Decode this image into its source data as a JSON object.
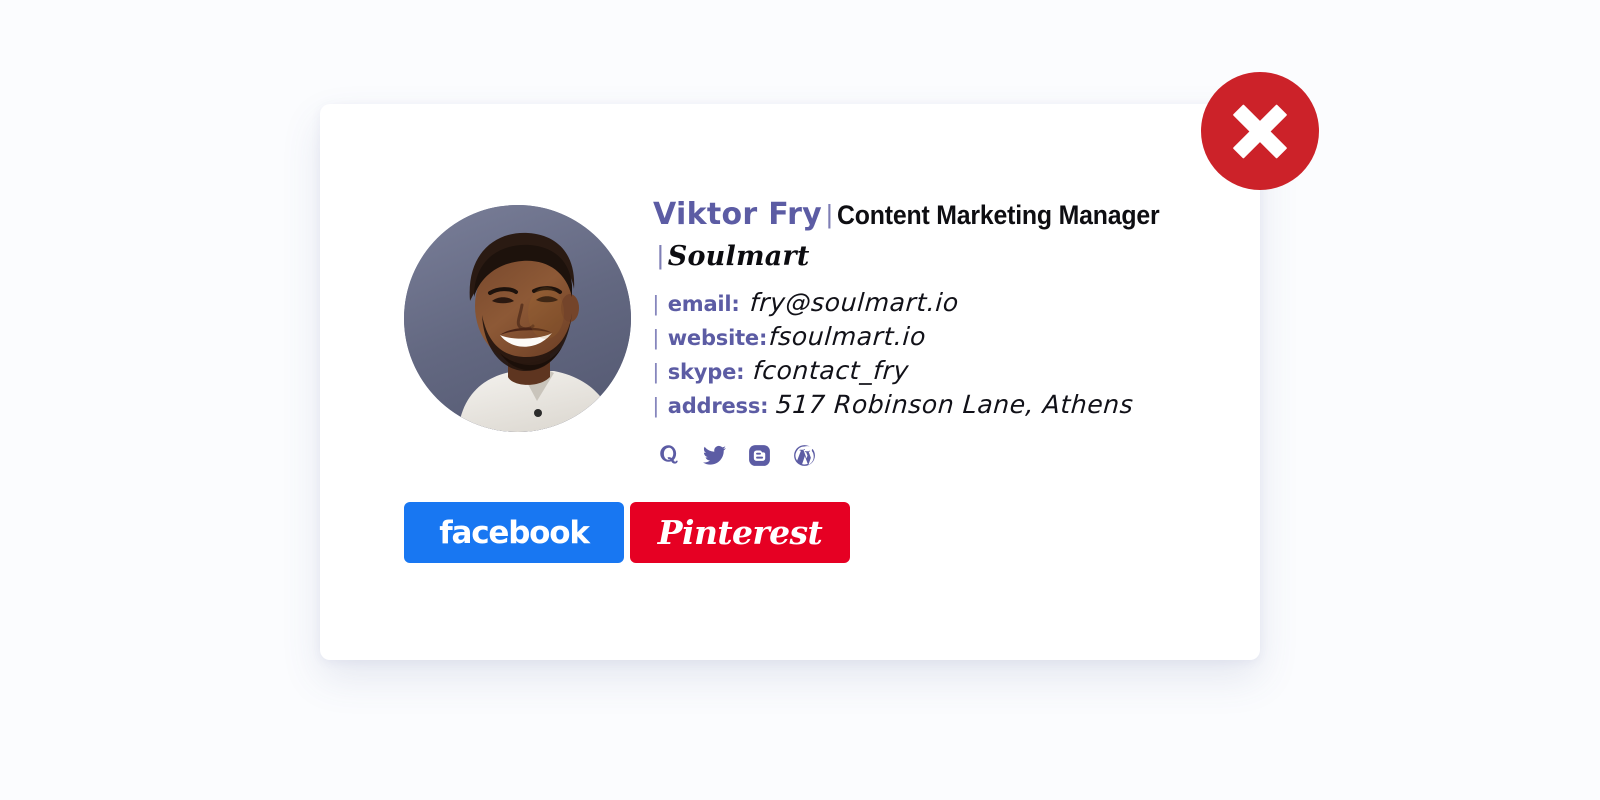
{
  "page": {
    "background_color": "#fbfcfe"
  },
  "card": {
    "background_color": "#ffffff"
  },
  "close_button": {
    "icon": "close-x-icon",
    "color": "#cc2229",
    "label": ""
  },
  "avatar": {
    "icon": "profile-photo",
    "alt": "Portrait of Viktor Fry",
    "background_color": "#6a6f8c"
  },
  "profile": {
    "name": "Viktor Fry",
    "separator": "|",
    "job_title": "Content Marketing Manager",
    "company": "Soulmart",
    "accent_color": "#5c5ca4"
  },
  "contact": [
    {
      "bar": "|",
      "label": "email:",
      "value": "fry@soulmart.io"
    },
    {
      "bar": "|",
      "label": "website:",
      "value": "fsoulmart.io"
    },
    {
      "bar": "|",
      "label": "skype:",
      "value": "fcontact_fry"
    },
    {
      "bar": "|",
      "label": "address:",
      "value": "517 Robinson Lane, Athens"
    }
  ],
  "social": [
    {
      "icon": "quora-icon",
      "name": "Quora"
    },
    {
      "icon": "twitter-icon",
      "name": "Twitter"
    },
    {
      "icon": "blogger-icon",
      "name": "Blogger"
    },
    {
      "icon": "wordpress-icon",
      "name": "WordPress"
    }
  ],
  "cta": {
    "facebook": {
      "label": "facebook",
      "color": "#1877f2"
    },
    "pinterest": {
      "label": "Pinterest",
      "color": "#e60023"
    }
  }
}
